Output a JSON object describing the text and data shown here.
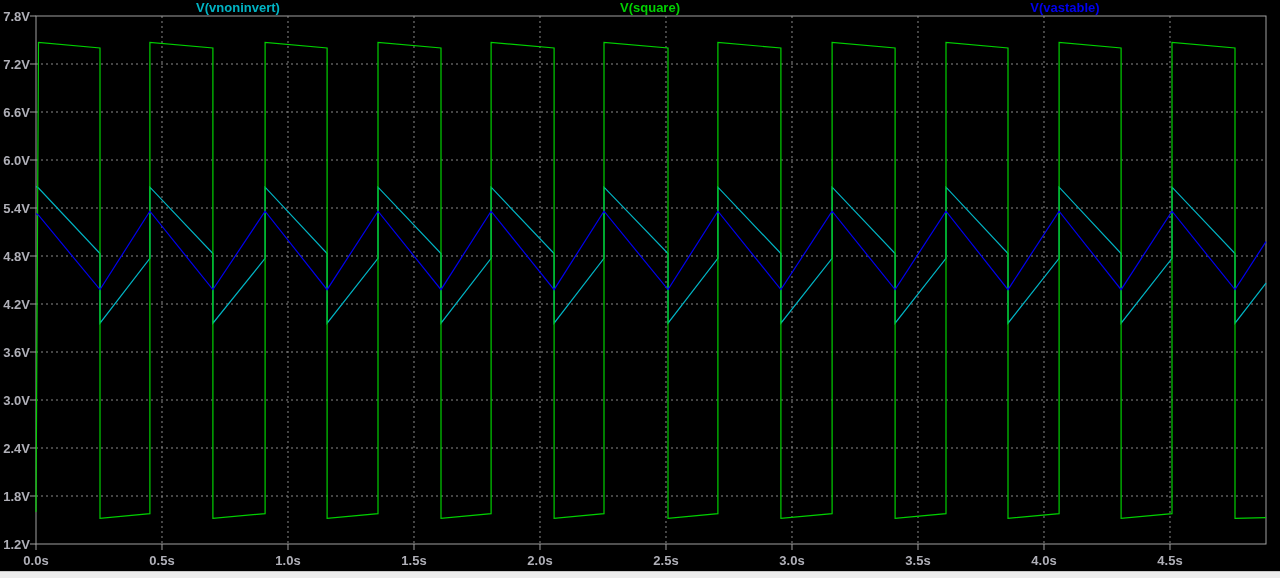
{
  "chart_data": {
    "type": "line",
    "grid": true,
    "xlim": [
      0,
      4.881
    ],
    "ylim": [
      1.2,
      7.8
    ],
    "xticks": [
      {
        "value": 0,
        "label": "0.0s"
      },
      {
        "value": 0.5,
        "label": "0.5s"
      },
      {
        "value": 1,
        "label": "1.0s"
      },
      {
        "value": 1.5,
        "label": "1.5s"
      },
      {
        "value": 2,
        "label": "2.0s"
      },
      {
        "value": 2.5,
        "label": "2.5s"
      },
      {
        "value": 3,
        "label": "3.0s"
      },
      {
        "value": 3.5,
        "label": "3.5s"
      },
      {
        "value": 4,
        "label": "4.0s"
      },
      {
        "value": 4.5,
        "label": "4.5s"
      }
    ],
    "yticks": [
      {
        "value": 1.2,
        "label": "1.2V"
      },
      {
        "value": 1.8,
        "label": "1.8V"
      },
      {
        "value": 2.4,
        "label": "2.4V"
      },
      {
        "value": 3.0,
        "label": "3.0V"
      },
      {
        "value": 3.6,
        "label": "3.6V"
      },
      {
        "value": 4.2,
        "label": "4.2V"
      },
      {
        "value": 4.8,
        "label": "4.8V"
      },
      {
        "value": 5.4,
        "label": "5.4V"
      },
      {
        "value": 6.0,
        "label": "6.0V"
      },
      {
        "value": 6.6,
        "label": "6.6V"
      },
      {
        "value": 7.2,
        "label": "7.2V"
      },
      {
        "value": 7.8,
        "label": "7.8V"
      }
    ],
    "x": [
      0,
      0.01,
      0.254,
      0.254,
      0.452,
      0.452,
      0.702,
      0.702,
      0.909,
      0.909,
      1.155,
      1.155,
      1.357,
      1.357,
      1.607,
      1.607,
      1.806,
      1.806,
      2.056,
      2.056,
      2.254,
      2.254,
      2.508,
      2.508,
      2.706,
      2.706,
      2.956,
      2.956,
      3.159,
      3.159,
      3.409,
      3.409,
      3.611,
      3.611,
      3.857,
      3.857,
      4.06,
      4.06,
      4.306,
      4.306,
      4.508,
      4.508,
      4.758,
      4.758,
      4.881
    ],
    "series": [
      {
        "name": "V(vnoninvert)",
        "color": "#00b4c4",
        "values": [
          5.67,
          5.65,
          4.83,
          3.96,
          4.77,
          5.66,
          4.83,
          3.96,
          4.77,
          5.66,
          4.83,
          3.96,
          4.77,
          5.66,
          4.83,
          3.96,
          4.77,
          5.66,
          4.83,
          3.96,
          4.77,
          5.66,
          4.83,
          3.96,
          4.77,
          5.66,
          4.83,
          3.96,
          4.77,
          5.66,
          4.83,
          3.96,
          4.77,
          5.66,
          4.83,
          3.96,
          4.77,
          5.66,
          4.83,
          3.96,
          4.77,
          5.66,
          4.83,
          3.96,
          4.46
        ]
      },
      {
        "name": "V(square)",
        "color": "#00d000",
        "values": [
          1.6,
          7.47,
          7.4,
          1.52,
          1.58,
          7.47,
          7.4,
          1.52,
          1.58,
          7.47,
          7.4,
          1.52,
          1.58,
          7.47,
          7.4,
          1.52,
          1.58,
          7.47,
          7.4,
          1.52,
          1.58,
          7.47,
          7.4,
          1.52,
          1.58,
          7.47,
          7.4,
          1.52,
          1.58,
          7.47,
          7.4,
          1.52,
          1.58,
          7.47,
          7.4,
          1.52,
          1.58,
          7.47,
          7.4,
          1.52,
          1.58,
          7.47,
          7.4,
          1.52,
          1.53
        ]
      },
      {
        "name": "V(vastable)",
        "color": "#0000ee",
        "values": [
          5.33,
          5.31,
          4.38,
          4.38,
          5.36,
          5.36,
          4.38,
          4.38,
          5.36,
          5.36,
          4.38,
          4.38,
          5.36,
          5.36,
          4.38,
          4.38,
          5.36,
          5.36,
          4.38,
          4.38,
          5.36,
          5.36,
          4.38,
          4.38,
          5.36,
          5.36,
          4.38,
          4.38,
          5.36,
          5.36,
          4.38,
          4.38,
          5.36,
          5.36,
          4.38,
          4.38,
          5.36,
          5.36,
          4.38,
          4.38,
          5.36,
          5.36,
          4.38,
          4.38,
          4.98
        ]
      }
    ]
  }
}
